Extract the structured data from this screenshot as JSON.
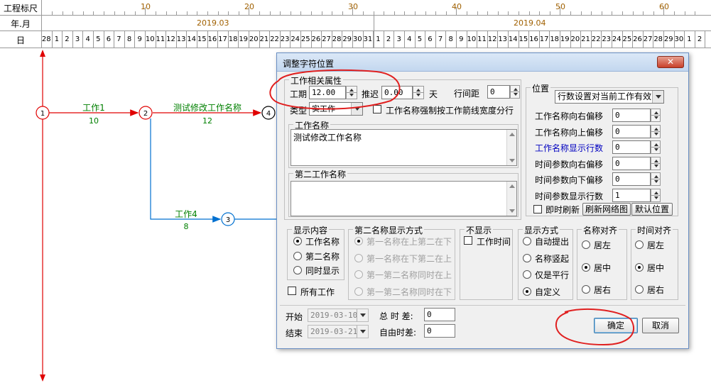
{
  "scale": {
    "row1_label": "工程标尺",
    "row2_label": "年.月",
    "row3_label": "日",
    "ruler_ticks": [
      "10",
      "20",
      "30",
      "40",
      "50",
      "60"
    ],
    "months": [
      "2019.03",
      "2019.04"
    ],
    "march_days": [
      "28",
      "1",
      "2",
      "3",
      "4",
      "5",
      "6",
      "7",
      "8",
      "9",
      "10",
      "11",
      "12",
      "13",
      "14",
      "15",
      "16",
      "17",
      "18",
      "19",
      "20",
      "21",
      "22",
      "23",
      "24",
      "25",
      "26",
      "27",
      "28",
      "29",
      "30",
      "31"
    ],
    "april_days": [
      "1",
      "2",
      "3",
      "4",
      "5",
      "6",
      "7",
      "8",
      "9",
      "10",
      "11",
      "12",
      "13",
      "14",
      "15",
      "16",
      "17",
      "18",
      "19",
      "20",
      "21",
      "22",
      "23",
      "24",
      "25",
      "26",
      "27",
      "28",
      "29",
      "30",
      "1",
      "2"
    ]
  },
  "network": {
    "nodes": [
      "1",
      "2",
      "3",
      "4"
    ],
    "activities": [
      {
        "name": "工作1",
        "duration": "10"
      },
      {
        "name": "测试修改工作名称",
        "duration": "12"
      },
      {
        "name": "工作4",
        "duration": "8"
      }
    ],
    "colors": {
      "critical": "#e00000",
      "normal": "#0070d0",
      "label": "#008000"
    }
  },
  "dialog": {
    "title": "调整字符位置",
    "close_label": "✕",
    "work_props": {
      "title": "工作相关属性",
      "duration_label": "工期",
      "duration_value": "12.00",
      "delay_label": "推迟",
      "delay_value": "0.00",
      "unit_label": "天",
      "spacing_label": "行间距",
      "spacing_value": "0",
      "type_label": "类型",
      "type_value": "实工作",
      "force_split_label": "工作名称强制按工作箭线宽度分行",
      "name_group_title": "工作名称",
      "name_value": "测试修改工作名称",
      "second_name_group_title": "第二工作名称",
      "second_name_value": ""
    },
    "position": {
      "title": "位置",
      "mode_value": "行数设置对当前工作有效",
      "fields": [
        {
          "label": "工作名称向右偏移",
          "value": "0",
          "blue": false
        },
        {
          "label": "工作名称向上偏移",
          "value": "0",
          "blue": false
        },
        {
          "label": "工作名称显示行数",
          "value": "0",
          "blue": true
        },
        {
          "label": "时间参数向右偏移",
          "value": "0",
          "blue": false
        },
        {
          "label": "时间参数向下偏移",
          "value": "0",
          "blue": false
        },
        {
          "label": "时间参数显示行数",
          "value": "1",
          "blue": false
        }
      ],
      "instant_refresh_label": "即时刷新",
      "refresh_network_label": "刷新网络图",
      "default_position_label": "默认位置"
    },
    "display_content": {
      "title": "显示内容",
      "options": [
        "工作名称",
        "第二名称",
        "同时显示"
      ],
      "selected": 0,
      "all_work_label": "所有工作"
    },
    "second_name_mode": {
      "title": "第二名称显示方式",
      "options": [
        "第一名称在上第二在下",
        "第一名称在下第二在上",
        "第一第二名称同时在上",
        "第一第二名称同时在下"
      ],
      "selected": 0
    },
    "hide": {
      "title": "不显示",
      "work_time_label": "工作时间"
    },
    "display_mode": {
      "title": "显示方式",
      "options": [
        "自动提出",
        "名称竖起",
        "仅是平行",
        "自定义"
      ],
      "selected": 3
    },
    "name_align": {
      "title": "名称对齐",
      "options": [
        "居左",
        "居中",
        "居右"
      ],
      "selected": 1
    },
    "time_align": {
      "title": "时间对齐",
      "options": [
        "居左",
        "居中",
        "居右"
      ],
      "selected": 1
    },
    "bottom": {
      "start_label": "开始",
      "start_value": "2019-03-10",
      "end_label": "结束",
      "end_value": "2019-03-21",
      "total_float_label": "总 时 差:",
      "total_float_value": "0",
      "free_float_label": "自由时差:",
      "free_float_value": "0",
      "ok_label": "确定",
      "cancel_label": "取消"
    }
  }
}
